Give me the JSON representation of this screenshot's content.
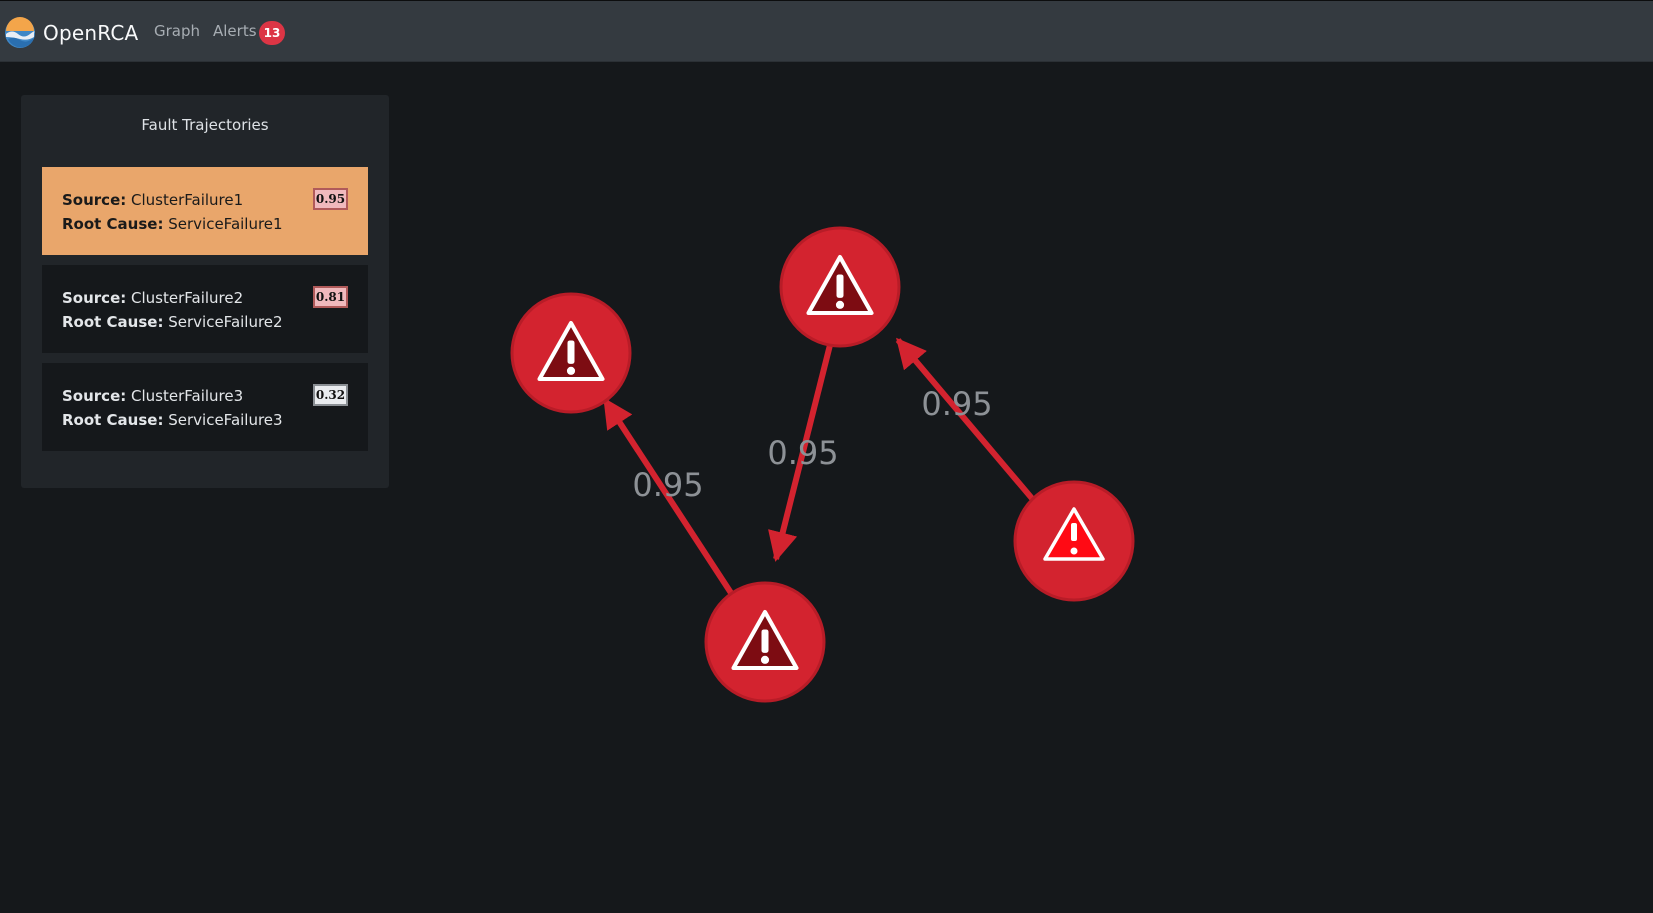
{
  "header": {
    "brand": "OpenRCA",
    "nav": {
      "graph": "Graph",
      "alerts": "Alerts",
      "alerts_count": "13"
    }
  },
  "panel": {
    "title": "Fault Trajectories",
    "source_label": "Source:",
    "root_cause_label": "Root Cause:",
    "items": [
      {
        "source": "ClusterFailure1",
        "root_cause": "ServiceFailure1",
        "score": "0.95",
        "selected": true
      },
      {
        "source": "ClusterFailure2",
        "root_cause": "ServiceFailure2",
        "score": "0.81",
        "selected": false
      },
      {
        "source": "ClusterFailure3",
        "root_cause": "ServiceFailure3",
        "score": "0.32",
        "selected": false
      }
    ]
  },
  "graph": {
    "node_icon": "warning-triangle-icon",
    "edge_color": "#d3232f",
    "node_color": "#d3232f",
    "edges": [
      {
        "label": "0.95"
      },
      {
        "label": "0.95"
      },
      {
        "label": "0.95"
      }
    ]
  }
}
